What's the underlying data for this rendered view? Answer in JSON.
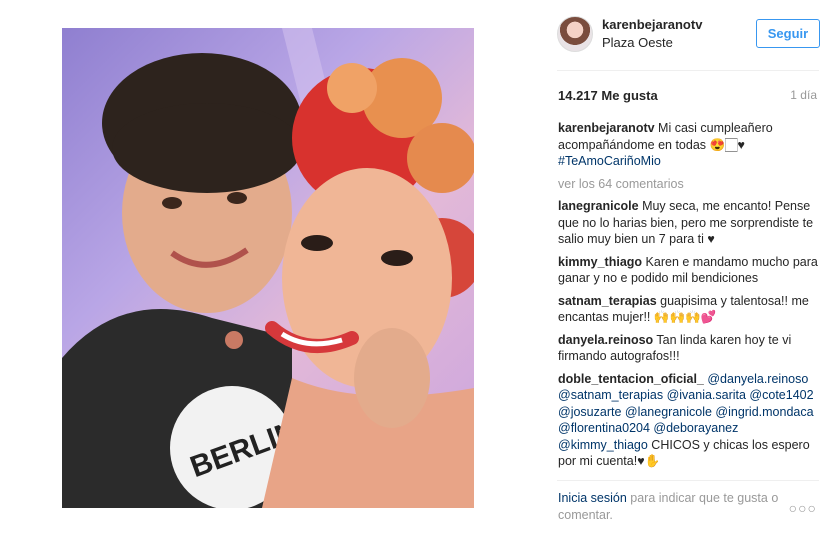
{
  "post": {
    "username": "karenbejaranotv",
    "location": "Plaza Oeste",
    "follow_label": "Seguir",
    "likes": "14.217 Me gusta",
    "time": "1 día"
  },
  "caption": {
    "user": "karenbejaranotv",
    "text": " Mi casi cumpleañero acompañándome en todas 😍🏻♥",
    "hashtag": "#TeAmoCariñoMio"
  },
  "more_comments": "ver los 64 comentarios",
  "comments": [
    {
      "user": "lanegranicole",
      "text": " Muy seca, me encanto! Pense que no lo harias bien, pero me sorprendiste te salio muy bien un 7 para ti ♥"
    },
    {
      "user": "kimmy_thiago",
      "text": " Karen e mandamo mucho para ganar y no e podido mil bendiciones"
    },
    {
      "user": "satnam_terapias",
      "text": " guapisima y talentosa!! me encantas mujer!! 🙌🙌🙌💕"
    },
    {
      "user": "danyela.reinoso",
      "text": " Tan linda karen hoy te vi firmando autografos!!!"
    },
    {
      "user": "doble_tentacion_oficial_",
      "mentions": "@danyela.reinoso @satnam_terapias @ivania.sarita @cote1402 @josuzarte @lanegranicole @ingrid.mondaca @florentina0204 @deborayanez @kimmy_thiago",
      "text": " CHICOS y chicas los espero por mi cuenta!♥✋"
    }
  ],
  "footer": {
    "login_label": "Inicia sesión",
    "text": " para indicar que te gusta o comentar.",
    "more_label": "○○○"
  }
}
